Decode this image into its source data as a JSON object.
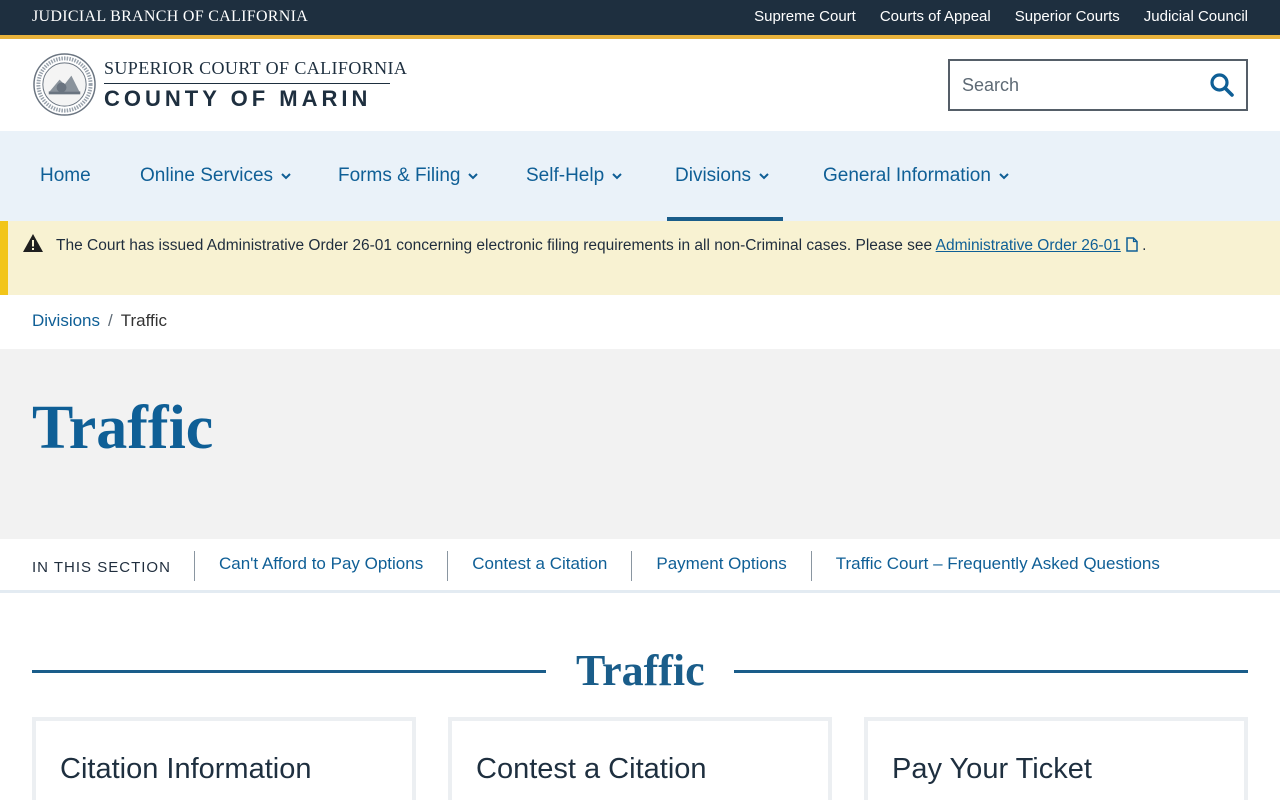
{
  "topbar": {
    "branch": "JUDICIAL BRANCH OF CALIFORNIA",
    "links": [
      "Supreme Court",
      "Courts of Appeal",
      "Superior Courts",
      "Judicial Council"
    ]
  },
  "header": {
    "logo_line1": "SUPERIOR COURT OF CALIFORNIA",
    "logo_line2": "COUNTY OF MARIN",
    "search_placeholder": "Search"
  },
  "nav": {
    "items": [
      {
        "label": "Home",
        "dropdown": false
      },
      {
        "label": "Online Services",
        "dropdown": true
      },
      {
        "label": "Forms & Filing",
        "dropdown": true
      },
      {
        "label": "Self-Help",
        "dropdown": true
      },
      {
        "label": "Divisions",
        "dropdown": true,
        "active": true
      },
      {
        "label": "General Information",
        "dropdown": true
      }
    ]
  },
  "alert": {
    "text": "The Court has issued Administrative Order 26-01 concerning electronic filing requirements in all non-Criminal cases. Please see ",
    "link_text": "Administrative Order 26-01",
    "trailing": " ."
  },
  "breadcrumb": {
    "items": [
      "Divisions",
      "Traffic"
    ]
  },
  "hero": {
    "title": "Traffic"
  },
  "section_nav": {
    "label": "IN THIS SECTION",
    "links": [
      "Can't Afford to Pay Options",
      "Contest a Citation",
      "Payment Options",
      "Traffic Court – Frequently Asked Questions"
    ]
  },
  "content": {
    "heading": "Traffic",
    "cards": [
      "Citation Information",
      "Contest a Citation",
      "Pay Your Ticket"
    ]
  },
  "colors": {
    "topbar": "#1e2f3f",
    "accent": "#e8b23b",
    "link": "#0f5f96",
    "nav_bg": "#eaf2f9",
    "alert_bg": "#f8f2d2",
    "alert_border": "#f2c518"
  },
  "icons": {
    "search": "search-icon",
    "chevron": "chevron-down-icon",
    "alert": "warning-icon",
    "document": "document-icon",
    "seal": "court-seal"
  }
}
